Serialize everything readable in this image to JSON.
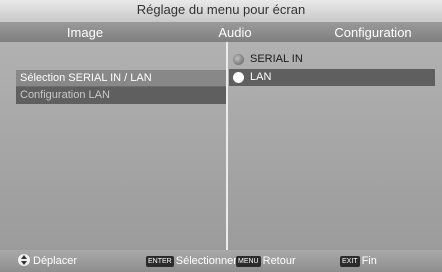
{
  "header": {
    "title": "Réglage du menu pour écran",
    "tabs": [
      {
        "label": "Image"
      },
      {
        "label": "Audio"
      },
      {
        "label": "Configuration"
      }
    ]
  },
  "left_menu": {
    "items": [
      {
        "label": "Sélection SERIAL IN / LAN"
      },
      {
        "label": "Configuration LAN"
      }
    ]
  },
  "options": {
    "items": [
      {
        "label": "SERIAL IN"
      },
      {
        "label": "LAN"
      }
    ]
  },
  "footer": {
    "move": {
      "label": "Déplacer"
    },
    "enter": {
      "key": "ENTER",
      "label": "Sélectionner"
    },
    "menu": {
      "key": "MENU",
      "label": "Retour"
    },
    "exit": {
      "key": "EXIT",
      "label": "Fin"
    }
  }
}
